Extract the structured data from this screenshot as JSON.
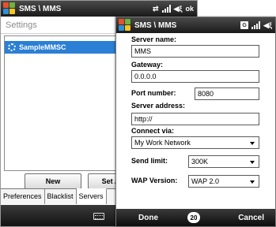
{
  "back_window": {
    "title": "SMS \\ MMS",
    "status_ok": "ok",
    "subheader": "Settings",
    "server_item": "SampleMMSC",
    "buttons": {
      "new": "New",
      "set_as_default": "Set As D"
    },
    "tabs": [
      "Preferences",
      "Blacklist",
      "Servers"
    ]
  },
  "front_window": {
    "title": "SMS \\ MMS",
    "g_badge": "G",
    "server_name_label": "Server name:",
    "server_name_value": "MMS",
    "gateway_label": "Gateway:",
    "gateway_value": "0.0.0.0",
    "port_label": "Port number:",
    "port_value": "8080",
    "server_address_label": "Server address:",
    "server_address_value": "http://",
    "connect_via_label": "Connect via:",
    "connect_via_value": "My Work Network",
    "send_limit_label": "Send limit:",
    "send_limit_value": "300K",
    "wap_version_label": "WAP Version:",
    "wap_version_value": "WAP 2.0",
    "softkeys": {
      "left": "Done",
      "center": "20",
      "right": "Cancel"
    }
  },
  "colors": {
    "selection": "#2b7fd4",
    "titlebar": "#1a1a1a"
  },
  "icons": [
    "windows-flag-icon",
    "signal-icon",
    "volume-icon",
    "keyboard-icon",
    "server-gear-icon"
  ]
}
